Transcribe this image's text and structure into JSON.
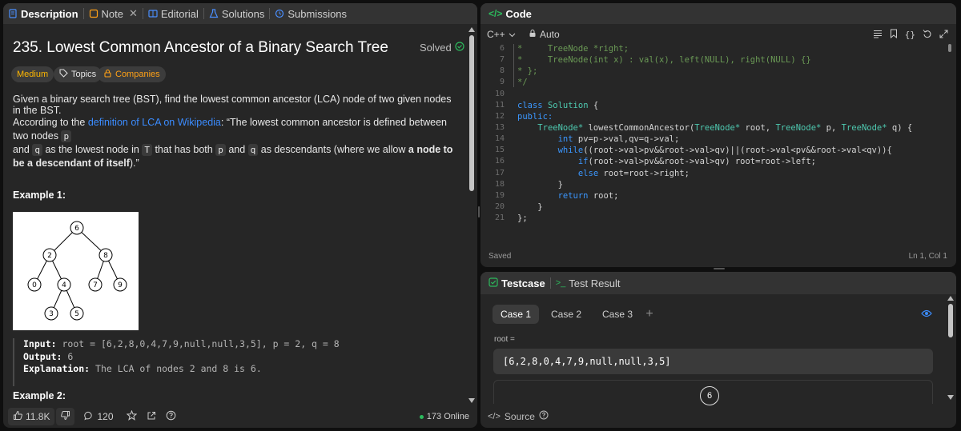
{
  "tabs": {
    "description": "Description",
    "note": "Note",
    "editorial": "Editorial",
    "solutions": "Solutions",
    "submissions": "Submissions"
  },
  "problem": {
    "title": "235. Lowest Common Ancestor of a Binary Search Tree",
    "status": "Solved",
    "difficulty": "Medium",
    "topics": "Topics",
    "companies": "Companies",
    "p1": "Given a binary search tree (BST), find the lowest common ancestor (LCA) node of two given nodes in the BST.",
    "p2_a": "According to the ",
    "p2_link": "definition of LCA on Wikipedia",
    "p2_b": ": “The lowest common ancestor is defined between two nodes ",
    "p2_p": "p",
    "p2_c": "and ",
    "p2_q": "q",
    "p2_d": " as the lowest node in ",
    "p2_T": "T",
    "p2_e": " that has both ",
    "p2_p2": "p",
    "p2_f": " and ",
    "p2_q2": "q",
    "p2_g": " as descendants (where we allow ",
    "p2_bold": "a node to be a descendant of itself",
    "p2_h": ").”",
    "example1": "Example 1:",
    "tree_nodes": [
      "6",
      "2",
      "8",
      "0",
      "4",
      "7",
      "9",
      "3",
      "5"
    ],
    "input_label": "Input:",
    "input_value": "root = [6,2,8,0,4,7,9,null,null,3,5], p = 2, q = 8",
    "output_label": "Output:",
    "output_value": "6",
    "expl_label": "Explanation:",
    "expl_value": "The LCA of nodes 2 and 8 is 6.",
    "example2": "Example 2:"
  },
  "footer": {
    "likes": "11.8K",
    "comments": "120",
    "online": "173 Online"
  },
  "code": {
    "title": "Code",
    "language": "C++",
    "auto": "Auto",
    "saved": "Saved",
    "cursor": "Ln 1, Col 1",
    "line_numbers": [
      "6",
      "7",
      "8",
      "9",
      "10",
      "11",
      "12",
      "13",
      "14",
      "15",
      "16",
      "17",
      "18",
      "19",
      "20",
      "21"
    ]
  },
  "testcase": {
    "tab": "Testcase",
    "result_tab": "Test Result",
    "cases": [
      "Case 1",
      "Case 2",
      "Case 3"
    ],
    "root_label": "root =",
    "root_value": "[6,2,8,0,4,7,9,null,null,3,5]",
    "source": "Source",
    "bubble": "6"
  },
  "colors": {
    "accent": "#ffa116",
    "success": "#2cbb5d",
    "link": "#3b8cff"
  }
}
